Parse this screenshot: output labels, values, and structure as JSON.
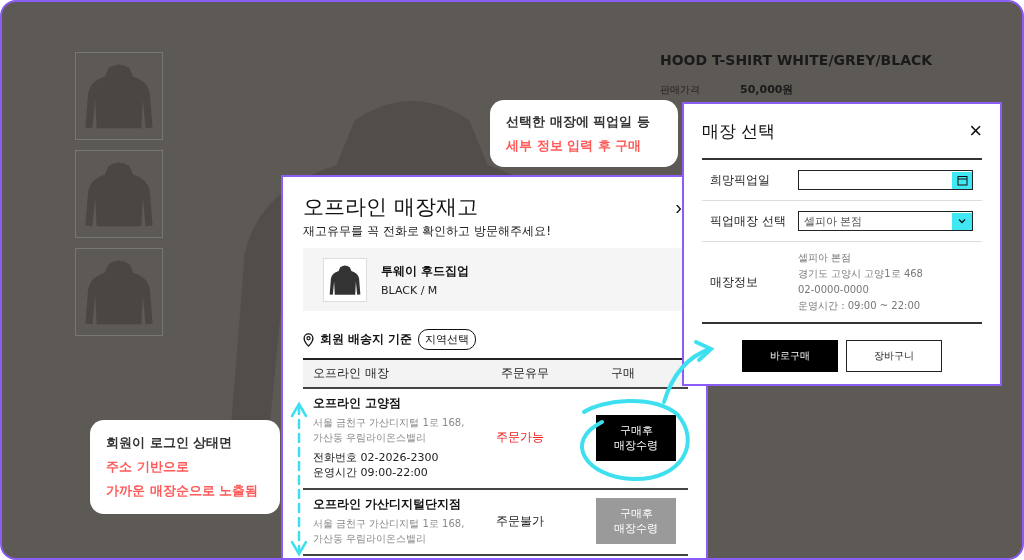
{
  "product_page": {
    "title": "HOOD T-SHIRT WHITE/GREY/BLACK",
    "price_label": "판매가격",
    "price": "50,000원"
  },
  "stock_modal": {
    "title": "오프라인 매장재고",
    "close": "›",
    "subtitle": "재고유무를 꼭 전화로 확인하고 방문해주세요!",
    "product": {
      "name": "투웨이 후드집업",
      "option": "BLACK / M"
    },
    "location_label": "회원 배송지 기준",
    "region_button": "지역선택",
    "columns": [
      "오프라인 매장",
      "주문유무",
      "구매"
    ],
    "stores": [
      {
        "name": "오프라인 고양점",
        "address": [
          "서울 금천구 가산디지털 1로 168,",
          "가산동 우림라이온스밸리"
        ],
        "phone": "전화번호 02-2026-2300",
        "hours": "운영시간 09:00-22:00",
        "status": "주문가능",
        "available": true,
        "button": "구매후 매장수령"
      },
      {
        "name": "오프라인 가산디지털단지점",
        "address": [
          "서울 금천구 가산디지털 1로 168,",
          "가산동 우림라이온스밸리"
        ],
        "status": "주문불가",
        "available": false,
        "button": "구매후 매장수령"
      }
    ]
  },
  "store_select_modal": {
    "title": "매장 선택",
    "close": "×",
    "fields": [
      {
        "label": "희망픽업일",
        "kind": "date"
      },
      {
        "label": "픽업매장 선택",
        "kind": "select",
        "value": "셀피아 본점"
      }
    ],
    "info_label": "매장정보",
    "info_lines": [
      "셀피아 본점",
      "경기도 고양시 고양1로 468",
      "02-0000-0000",
      "운영시간 : 09:00 ~ 22:00"
    ],
    "buttons": [
      {
        "label": "바로구매",
        "kind": "primary"
      },
      {
        "label": "장바구니",
        "kind": "secondary"
      }
    ]
  },
  "callouts": [
    {
      "lines": [
        {
          "text": "선택한 매장에 픽업일 등",
          "highlight": false
        },
        {
          "text": "세부 정보 입력 후 구매",
          "highlight": true
        }
      ]
    },
    {
      "lines": [
        {
          "text": "회원이 로그인 상태면",
          "highlight": false
        },
        {
          "text": "주소 기반으로",
          "highlight": true
        },
        {
          "text": "가까운 매장순으로 노출됨",
          "highlight": true
        }
      ]
    }
  ]
}
